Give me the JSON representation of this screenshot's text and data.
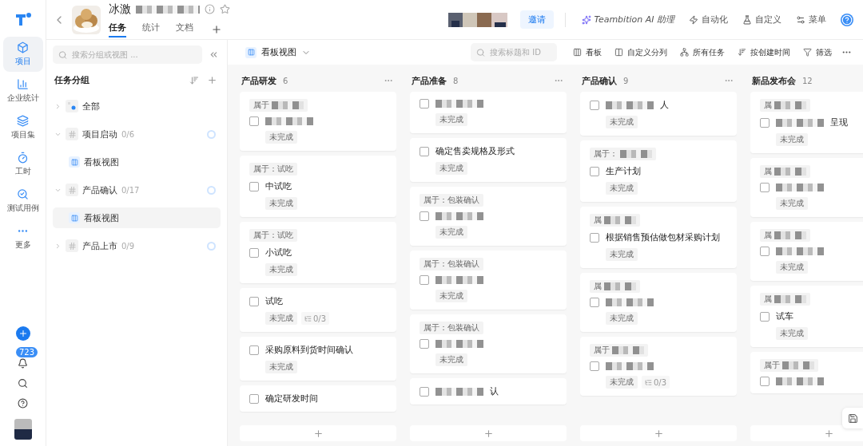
{
  "rail": {
    "items": [
      {
        "label": "项目",
        "selected": true
      },
      {
        "label": "企业统计",
        "selected": false
      },
      {
        "label": "项目集",
        "selected": false
      },
      {
        "label": "工时",
        "selected": false
      },
      {
        "label": "测试用例",
        "selected": false
      },
      {
        "label": "更多",
        "selected": false
      }
    ],
    "notification_count": "723"
  },
  "header": {
    "title": "冰激",
    "title_blurred": true,
    "tabs": [
      {
        "label": "任务",
        "selected": true
      },
      {
        "label": "统计",
        "selected": false
      },
      {
        "label": "文档",
        "selected": false
      }
    ],
    "invite": "邀请",
    "ai": "Teambition AI 助理",
    "actions": [
      {
        "label": "自动化"
      },
      {
        "label": "自定义"
      },
      {
        "label": "菜单"
      }
    ]
  },
  "sidebar": {
    "search": {
      "placeholder": "搜索分组或视图 ..."
    },
    "heading": "任务分组",
    "groups": [
      {
        "label": "全部",
        "kind": "all",
        "expanded": false
      },
      {
        "label": "项目启动",
        "kind": "group",
        "count": "0/6",
        "expanded": true,
        "children": [
          {
            "label": "看板视图",
            "selected": false
          }
        ]
      },
      {
        "label": "产品确认",
        "kind": "group",
        "count": "0/17",
        "expanded": true,
        "children": [
          {
            "label": "看板视图",
            "selected": true
          }
        ]
      },
      {
        "label": "产品上市",
        "kind": "group",
        "count": "0/9",
        "expanded": false
      }
    ]
  },
  "toolbar": {
    "view": "看板视图",
    "search": {
      "placeholder": "搜索标题和 ID"
    },
    "actions": [
      {
        "label": "看板"
      },
      {
        "label": "自定义分列"
      },
      {
        "label": "所有任务"
      },
      {
        "label": "按创建时间"
      },
      {
        "label": "筛选"
      }
    ]
  },
  "columns": [
    {
      "title": "产品研发",
      "count": "6",
      "cards": [
        {
          "tag": "属于",
          "tag_blurred": true,
          "title_blurred": true,
          "checked": false,
          "status": "未完成"
        },
        {
          "tag": "属于：试吃",
          "title": "中试吃",
          "checked": false,
          "status": "未完成"
        },
        {
          "tag": "属于：试吃",
          "title": "小试吃",
          "checked": false,
          "status": "未完成"
        },
        {
          "title": "试吃",
          "checked": false,
          "status": "未完成",
          "subtasks": "0/3"
        },
        {
          "title": "采购原料到货时间确认",
          "checked": false,
          "status": "未完成"
        },
        {
          "title": "确定研发时间",
          "checked": false
        }
      ]
    },
    {
      "title": "产品准备",
      "count": "8",
      "cards": [
        {
          "title_blurred": true,
          "checked": false,
          "status": "未完成"
        },
        {
          "title": "确定售卖规格及形式",
          "checked": false,
          "status": "未完成"
        },
        {
          "tag": "属于：包装确认",
          "title_blurred": true,
          "checked": false,
          "status": "未完成"
        },
        {
          "tag": "属于：包装确认",
          "title_blurred": true,
          "checked": false,
          "status": "未完成"
        },
        {
          "tag": "属于：包装确认",
          "title_blurred": true,
          "checked": false,
          "status": "未完成"
        },
        {
          "title": "认",
          "title_blurred": true,
          "checked": false
        }
      ]
    },
    {
      "title": "产品确认",
      "count": "9",
      "cards": [
        {
          "title": "人",
          "title_blurred": true,
          "checked": false,
          "status": "未完成"
        },
        {
          "tag": "属于：",
          "tag_blurred": true,
          "title": "生产计划",
          "checked": false,
          "status": "未完成"
        },
        {
          "tag": "属",
          "tag_blurred": true,
          "title": "根据销售预估做包材采购计划",
          "checked": false,
          "status": "未完成"
        },
        {
          "tag": "属",
          "tag_blurred": true,
          "title_blurred": true,
          "checked": false,
          "status": "未完成"
        },
        {
          "tag": "属于",
          "tag_blurred": true,
          "title_blurred": true,
          "checked": false,
          "status": "未完成",
          "subtasks": "0/3"
        }
      ]
    },
    {
      "title": "新品发布会",
      "count": "12",
      "cards": [
        {
          "tag": "属",
          "tag_blurred": true,
          "title": "呈现",
          "title_blurred": true,
          "checked": false,
          "status": "未完成"
        },
        {
          "tag": "属",
          "tag_blurred": true,
          "title_blurred": true,
          "checked": false,
          "status": "未完成"
        },
        {
          "tag": "属",
          "tag_blurred": true,
          "title_blurred": true,
          "checked": false,
          "status": "未完成"
        },
        {
          "tag": "属",
          "tag_blurred": true,
          "title": "试车",
          "checked": false,
          "status": "未完成"
        },
        {
          "tag": "属于",
          "tag_blurred": true,
          "title_blurred": true,
          "checked": false
        }
      ]
    }
  ]
}
